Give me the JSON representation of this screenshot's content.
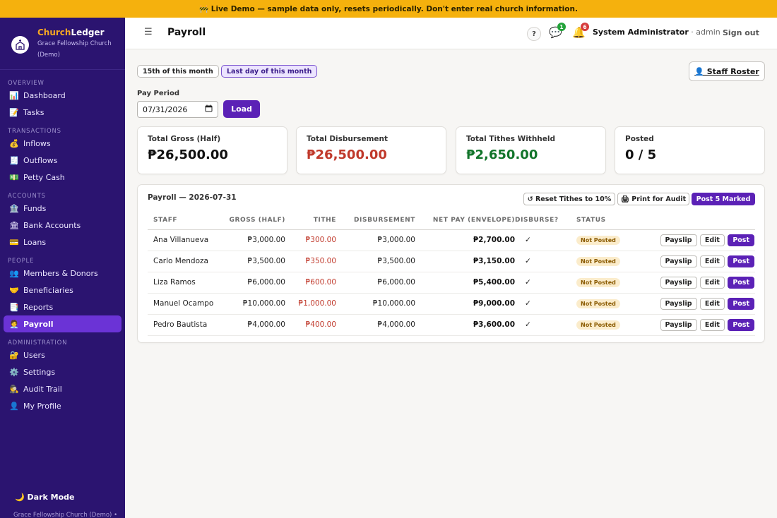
{
  "banner": "🚧 Live Demo — sample data only, resets periodically. Don't enter real church information.",
  "brand": {
    "name_a": "Church",
    "name_b": "Ledger",
    "church": "Grace Fellowship Church",
    "demo": "(Demo)"
  },
  "sidebar": {
    "sections": [
      {
        "title": "OVERVIEW",
        "items": [
          {
            "icon": "📊",
            "label": "Dashboard"
          },
          {
            "icon": "📝",
            "label": "Tasks"
          }
        ]
      },
      {
        "title": "TRANSACTIONS",
        "items": [
          {
            "icon": "💰",
            "label": "Inflows"
          },
          {
            "icon": "🧾",
            "label": "Outflows"
          },
          {
            "icon": "💵",
            "label": "Petty Cash"
          }
        ]
      },
      {
        "title": "ACCOUNTS",
        "items": [
          {
            "icon": "🏦",
            "label": "Funds"
          },
          {
            "icon": "🏛",
            "label": "Bank Accounts"
          },
          {
            "icon": "💳",
            "label": "Loans"
          }
        ]
      },
      {
        "title": "PEOPLE",
        "items": [
          {
            "icon": "👥",
            "label": "Members & Donors"
          },
          {
            "icon": "🤝",
            "label": "Beneficiaries"
          },
          {
            "icon": "📑",
            "label": "Reports"
          },
          {
            "icon": "🧑‍💼",
            "label": "Payroll",
            "active": true
          }
        ]
      },
      {
        "title": "ADMINISTRATION",
        "items": [
          {
            "icon": "🔐",
            "label": "Users"
          },
          {
            "icon": "⚙️",
            "label": "Settings"
          },
          {
            "icon": "🕵",
            "label": "Audit Trail"
          },
          {
            "icon": "👤",
            "label": "My Profile"
          }
        ]
      }
    ],
    "dark_mode": "🌙  Dark Mode",
    "footer": "Grace Fellowship Church (Demo) •"
  },
  "header": {
    "menu_icon": "☰",
    "title": "Payroll",
    "help": "?",
    "messages_count": "1",
    "notifications_count": "6",
    "user": "System Administrator",
    "role": " · admin",
    "signout": "Sign out"
  },
  "filters": {
    "chip1": "15th of this month",
    "chip2": "Last day of this month",
    "roster": "👤 Staff Roster"
  },
  "pay_period": {
    "label": "Pay Period",
    "value": "07/31/2026",
    "load": "Load"
  },
  "summary": [
    {
      "title": "Total Gross (Half)",
      "value": "₱26,500.00",
      "color": "default"
    },
    {
      "title": "Total Disbursement",
      "value": "₱26,500.00",
      "color": "red"
    },
    {
      "title": "Total Tithes Withheld",
      "value": "₱2,650.00",
      "color": "green"
    },
    {
      "title": "Posted",
      "value": "0 / 5",
      "color": "default"
    }
  ],
  "payroll": {
    "title": "Payroll — 2026-07-31",
    "reset_btn": "↺ Reset Tithes to 10%",
    "print_btn": "🖨 Print for Audit",
    "post_marked_btn": "Post 5 Marked",
    "columns": [
      "STAFF",
      "GROSS (HALF)",
      "TITHE",
      "DISBURSEMENT",
      "NET PAY (ENVELOPE)",
      "DISBURSE?",
      "STATUS"
    ],
    "rows": [
      {
        "staff": "Ana Villanueva",
        "gross": "₱3,000.00",
        "tithe": "₱300.00",
        "disbursement": "₱3,000.00",
        "net": "₱2,700.00",
        "disburse": "✓",
        "status": "Not Posted"
      },
      {
        "staff": "Carlo Mendoza",
        "gross": "₱3,500.00",
        "tithe": "₱350.00",
        "disbursement": "₱3,500.00",
        "net": "₱3,150.00",
        "disburse": "✓",
        "status": "Not Posted"
      },
      {
        "staff": "Liza Ramos",
        "gross": "₱6,000.00",
        "tithe": "₱600.00",
        "disbursement": "₱6,000.00",
        "net": "₱5,400.00",
        "disburse": "✓",
        "status": "Not Posted"
      },
      {
        "staff": "Manuel Ocampo",
        "gross": "₱10,000.00",
        "tithe": "₱1,000.00",
        "disbursement": "₱10,000.00",
        "net": "₱9,000.00",
        "disburse": "✓",
        "status": "Not Posted"
      },
      {
        "staff": "Pedro Bautista",
        "gross": "₱4,000.00",
        "tithe": "₱400.00",
        "disbursement": "₱4,000.00",
        "net": "₱3,600.00",
        "disburse": "✓",
        "status": "Not Posted"
      }
    ],
    "actions": {
      "payslip": "Payslip",
      "edit": "Edit",
      "post": "Post"
    }
  },
  "colors": {
    "banner": "#f5b10d",
    "sidebar": "#2b1470",
    "accent": "#5b21b6",
    "active_nav": "#6b33d6",
    "danger": "#c0392b",
    "success": "#12752b"
  }
}
